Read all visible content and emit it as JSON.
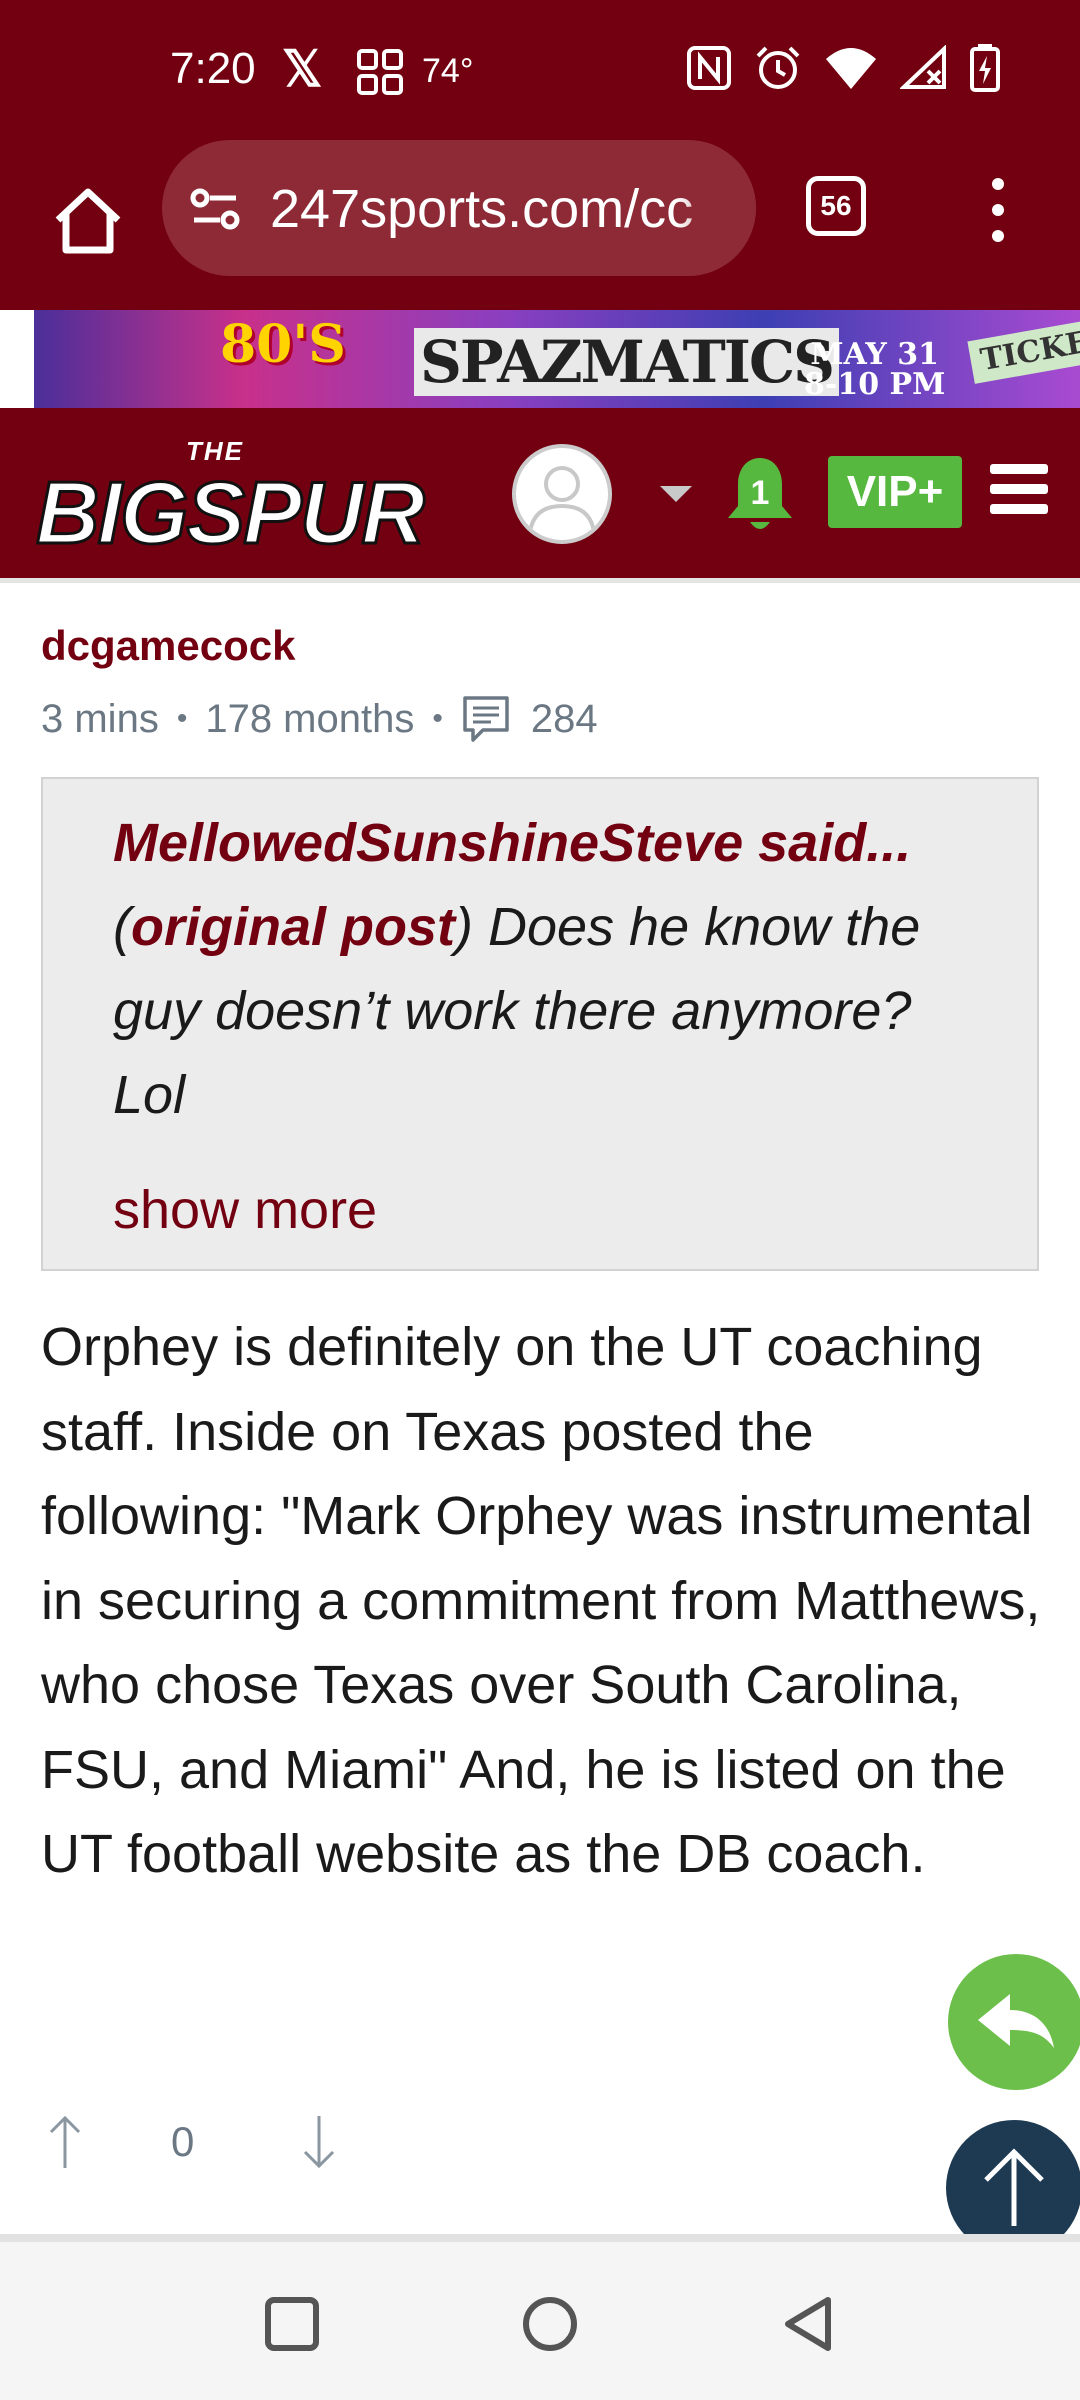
{
  "status_bar": {
    "time": "7:20",
    "temperature": "74°",
    "icons": [
      "x-icon",
      "grid-icon",
      "nfc-icon",
      "alarm-icon",
      "wifi-icon",
      "signal-icon",
      "battery-charging-icon"
    ]
  },
  "browser": {
    "url": "247sports.com/cc",
    "tab_count": "56"
  },
  "ad": {
    "line1": "80'S",
    "line2": "SPAZMATICS",
    "date": "MAY 31",
    "time": "8-10 PM",
    "ticket": "TICKET"
  },
  "site_header": {
    "logo_top": "THE",
    "logo_main": "BIGSPUR",
    "notification_count": "1",
    "vip_label": "VIP+"
  },
  "post": {
    "author": "dcgamecock",
    "time_ago": "3 mins",
    "member_age": "178 months",
    "post_count": "284",
    "quote": {
      "name": "MellowedSunshineSteve said...",
      "link_label": "original post",
      "text": ") Does he know the guy doesn’t work there anymore? Lol",
      "show_more": "show more"
    },
    "body": "Orphey is definitely on the UT coaching staff. Inside on Texas posted the following: \"Mark Orphey was instrumental in securing a commitment from Matthews, who chose Texas over South Carolina, FSU, and Miami\" And, he is listed on the UT football website as the DB coach.",
    "vote_count": "0"
  },
  "colors": {
    "brand": "#730010",
    "vip": "#56b83f",
    "reply_fab": "#6dbf4b",
    "top_fab": "#1e3a52"
  }
}
